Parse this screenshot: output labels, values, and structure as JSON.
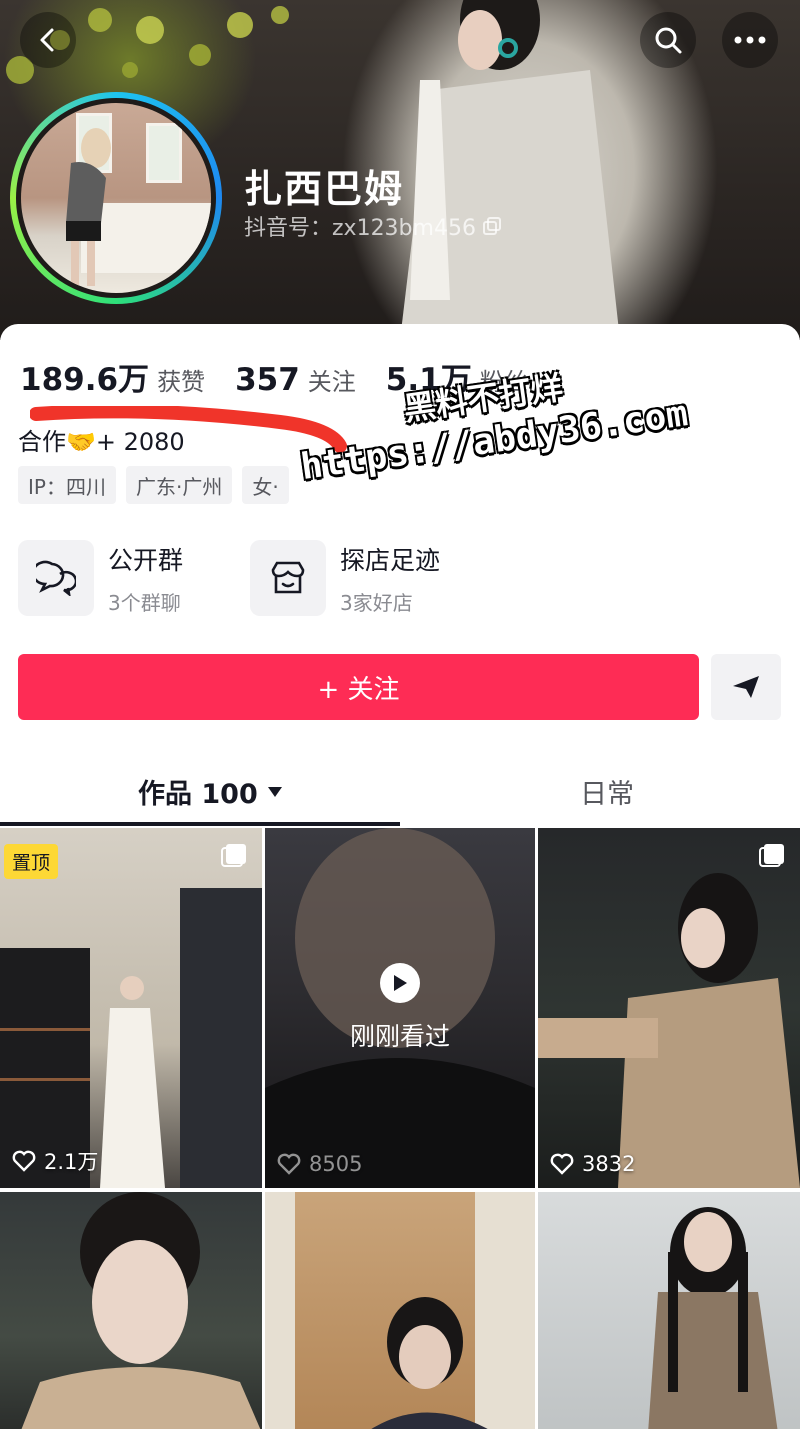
{
  "header": {
    "nickname": "扎西巴姆",
    "douyin_id": "抖音号：zx123bm456"
  },
  "stats": [
    {
      "value": "189.6万",
      "label": "获赞"
    },
    {
      "value": "357",
      "label": "关注"
    },
    {
      "value": "5.1万",
      "label": "粉丝"
    }
  ],
  "bio": "合作🤝+ 2080",
  "tags": [
    "IP：四川",
    "广东·广州",
    "女·"
  ],
  "watermark": {
    "line1": "黑料不打烊",
    "line2": "https://abdy36.com"
  },
  "features": {
    "group": {
      "title": "公开群",
      "subtitle": "3个群聊"
    },
    "shop": {
      "title": "探店足迹",
      "subtitle": "3家好店"
    }
  },
  "follow_button": "+ 关注",
  "tabs": {
    "works": "作品 100",
    "daily": "日常"
  },
  "videos": [
    {
      "likes": "2.1万",
      "badge": "置顶",
      "multi": true
    },
    {
      "likes": "8505",
      "overlay": "刚刚看过",
      "multi": false
    },
    {
      "likes": "3832",
      "multi": true
    },
    {
      "likes": "",
      "multi": false
    },
    {
      "likes": "",
      "multi": false
    },
    {
      "likes": "",
      "multi": false
    }
  ],
  "colors": {
    "accent": "#fe2c55",
    "pinned_badge": "#fdd835"
  },
  "icons": [
    "back-icon",
    "search-icon",
    "more-icon",
    "copy-icon",
    "chat-group-icon",
    "shop-icon",
    "share-arrow-icon",
    "dropdown-triangle-icon",
    "heart-icon",
    "play-icon",
    "multi-image-icon"
  ]
}
